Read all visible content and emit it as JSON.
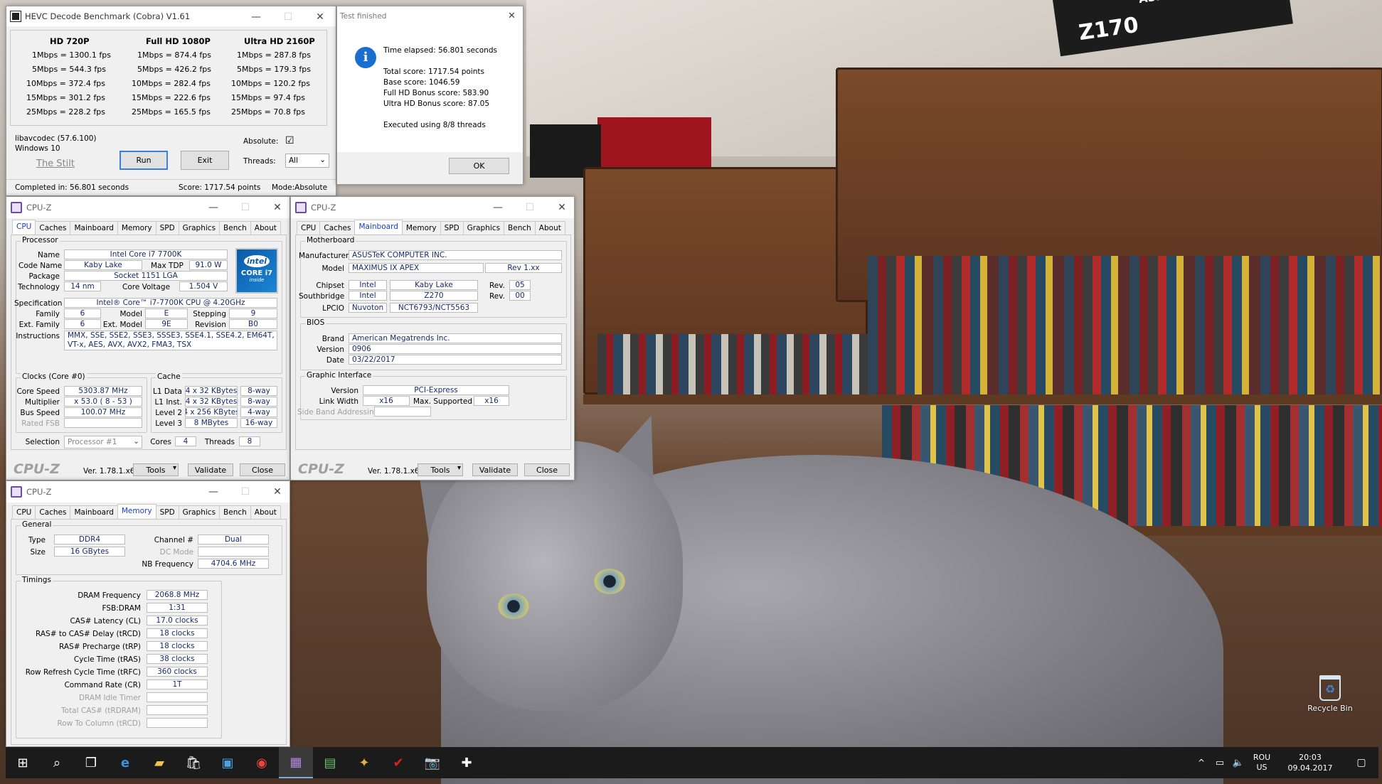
{
  "hevc": {
    "title": "HEVC Decode Benchmark (Cobra) V1.61",
    "columns": [
      "HD 720P",
      "Full HD 1080P",
      "Ultra HD 2160P"
    ],
    "rows": [
      [
        "1Mbps = 1300.1 fps",
        "1Mbps = 874.4 fps",
        "1Mbps = 287.8 fps"
      ],
      [
        "5Mbps = 544.3 fps",
        "5Mbps = 426.2 fps",
        "5Mbps = 179.3 fps"
      ],
      [
        "10Mbps = 372.4 fps",
        "10Mbps = 282.4 fps",
        "10Mbps = 120.2 fps"
      ],
      [
        "15Mbps = 301.2 fps",
        "15Mbps = 222.6 fps",
        "15Mbps = 97.4 fps"
      ],
      [
        "25Mbps = 228.2 fps",
        "25Mbps = 165.5 fps",
        "25Mbps = 70.8 fps"
      ]
    ],
    "lib": "libavcodec (57.6.100)",
    "os": "Windows 10",
    "link": "The Stilt",
    "run": "Run",
    "exit": "Exit",
    "absolute_label": "Absolute:",
    "absolute_check": "☑",
    "threads_label": "Threads:",
    "threads_value": "All",
    "status_completed": "Completed in: 56.801 seconds",
    "status_score": "Score: 1717.54 points",
    "status_mode": "Mode:Absolute"
  },
  "dialog": {
    "title": "Test finished",
    "lines": [
      "Time elapsed: 56.801 seconds",
      "Total score: 1717.54 points",
      "Base score: 1046.59",
      "Full HD Bonus score: 583.90",
      "Ultra HD Bonus score: 87.05",
      "Executed using 8/8 threads"
    ],
    "ok": "OK"
  },
  "cpuz_tabs": [
    "CPU",
    "Caches",
    "Mainboard",
    "Memory",
    "SPD",
    "Graphics",
    "Bench",
    "About"
  ],
  "cpuz_common": {
    "title": "CPU-Z",
    "logo": "CPU-Z",
    "version": "Ver. 1.78.1.x64",
    "tools": "Tools",
    "validate": "Validate",
    "close": "Close"
  },
  "cpu": {
    "group_processor": "Processor",
    "name_label": "Name",
    "name": "Intel Core i7 7700K",
    "codename_label": "Code Name",
    "codename": "Kaby Lake",
    "maxtdp_label": "Max TDP",
    "maxtdp": "91.0 W",
    "package_label": "Package",
    "package": "Socket 1151 LGA",
    "tech_label": "Technology",
    "tech": "14 nm",
    "voltage_label": "Core Voltage",
    "voltage": "1.504 V",
    "spec_label": "Specification",
    "spec": "Intel® Core™ i7-7700K CPU @ 4.20GHz",
    "family_label": "Family",
    "family": "6",
    "model_label": "Model",
    "model": "E",
    "stepping_label": "Stepping",
    "stepping": "9",
    "extfamily_label": "Ext. Family",
    "extfamily": "6",
    "extmodel_label": "Ext. Model",
    "extmodel": "9E",
    "revision_label": "Revision",
    "revision": "B0",
    "instr_label": "Instructions",
    "instr": "MMX, SSE, SSE2, SSE3, SSSE3, SSE4.1, SSE4.2, EM64T, VT-x, AES, AVX, AVX2, FMA3, TSX",
    "badge_brand": "intel",
    "badge_line1": "CORE i7",
    "badge_line2": "inside",
    "group_clocks": "Clocks (Core #0)",
    "corespeed_label": "Core Speed",
    "corespeed": "5303.87 MHz",
    "multiplier_label": "Multiplier",
    "multiplier": "x 53.0 ( 8 - 53 )",
    "busspeed_label": "Bus Speed",
    "busspeed": "100.07 MHz",
    "ratedfsb_label": "Rated FSB",
    "group_cache": "Cache",
    "l1d_label": "L1 Data",
    "l1d": "4 x 32 KBytes",
    "l1d_way": "8-way",
    "l1i_label": "L1 Inst.",
    "l1i": "4 x 32 KBytes",
    "l1i_way": "8-way",
    "l2_label": "Level 2",
    "l2": "4 x 256 KBytes",
    "l2_way": "4-way",
    "l3_label": "Level 3",
    "l3": "8 MBytes",
    "l3_way": "16-way",
    "selection_label": "Selection",
    "selection": "Processor #1",
    "cores_label": "Cores",
    "cores": "4",
    "threads_label": "Threads",
    "threads": "8"
  },
  "mainboard": {
    "group_mb": "Motherboard",
    "manuf_label": "Manufacturer",
    "manuf": "ASUSTeK COMPUTER INC.",
    "model_label": "Model",
    "model": "MAXIMUS IX APEX",
    "model_rev": "Rev 1.xx",
    "chipset_label": "Chipset",
    "chipset_vendor": "Intel",
    "chipset_name": "Kaby Lake",
    "rev_label": "Rev.",
    "chipset_rev": "05",
    "south_label": "Southbridge",
    "south_vendor": "Intel",
    "south_name": "Z270",
    "south_rev": "00",
    "lpcio_label": "LPCIO",
    "lpcio_vendor": "Nuvoton",
    "lpcio_name": "NCT6793/NCT5563",
    "group_bios": "BIOS",
    "brand_label": "Brand",
    "brand": "American Megatrends Inc.",
    "version_label": "Version",
    "version": "0906",
    "date_label": "Date",
    "date": "03/22/2017",
    "group_gfx": "Graphic Interface",
    "gver_label": "Version",
    "gver": "PCI-Express",
    "lw_label": "Link Width",
    "lw": "x16",
    "ms_label": "Max. Supported",
    "ms": "x16",
    "sba_label": "Side Band Addressing"
  },
  "memory": {
    "group_general": "General",
    "type_label": "Type",
    "type": "DDR4",
    "channel_label": "Channel #",
    "channel": "Dual",
    "size_label": "Size",
    "size": "16 GBytes",
    "dcmode_label": "DC Mode",
    "nbfreq_label": "NB Frequency",
    "nbfreq": "4704.6 MHz",
    "group_timings": "Timings",
    "timings": [
      {
        "label": "DRAM Frequency",
        "value": "2068.8 MHz"
      },
      {
        "label": "FSB:DRAM",
        "value": "1:31"
      },
      {
        "label": "CAS# Latency (CL)",
        "value": "17.0 clocks"
      },
      {
        "label": "RAS# to CAS# Delay (tRCD)",
        "value": "18 clocks"
      },
      {
        "label": "RAS# Precharge (tRP)",
        "value": "18 clocks"
      },
      {
        "label": "Cycle Time (tRAS)",
        "value": "38 clocks"
      },
      {
        "label": "Row Refresh Cycle Time (tRFC)",
        "value": "360 clocks"
      },
      {
        "label": "Command Rate (CR)",
        "value": "1T"
      },
      {
        "label": "DRAM Idle Timer",
        "value": ""
      },
      {
        "label": "Total CAS# (tRDRAM)",
        "value": ""
      },
      {
        "label": "Row To Column (tRCD)",
        "value": ""
      }
    ]
  },
  "desktop": {
    "board_text": "Z170",
    "board_brand": "ASRock",
    "recycle_label": "Recycle Bin"
  },
  "taskbar": {
    "lang1": "ROU",
    "lang2": "US",
    "time": "20:03",
    "date": "09.04.2017"
  }
}
